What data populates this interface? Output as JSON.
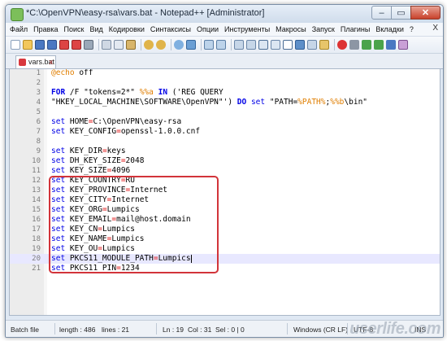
{
  "window": {
    "title": "*C:\\OpenVPN\\easy-rsa\\vars.bat - Notepad++ [Administrator]",
    "minimize": "–",
    "maximize": "▭",
    "close": "✕"
  },
  "menu": {
    "items": [
      "Файл",
      "Правка",
      "Поиск",
      "Вид",
      "Кодировки",
      "Синтаксисы",
      "Опции",
      "Инструменты",
      "Макросы",
      "Запуск",
      "Плагины",
      "Вкладки",
      "?"
    ],
    "close_x": "X"
  },
  "tab": {
    "label": "vars.bat",
    "close": "x"
  },
  "editor": {
    "current_line": 19,
    "lines": [
      {
        "n": "1"
      },
      {
        "n": "2"
      },
      {
        "n": "3"
      },
      {
        "n": "4"
      },
      {
        "n": "5"
      },
      {
        "n": "6"
      },
      {
        "n": "7"
      },
      {
        "n": "8"
      },
      {
        "n": "9"
      },
      {
        "n": "10"
      },
      {
        "n": "11"
      },
      {
        "n": "12"
      },
      {
        "n": "13"
      },
      {
        "n": "14"
      },
      {
        "n": "15"
      },
      {
        "n": "16"
      },
      {
        "n": "17"
      },
      {
        "n": "18"
      },
      {
        "n": "19"
      },
      {
        "n": "20"
      },
      {
        "n": "21"
      }
    ],
    "code": {
      "l1_at": "@echo",
      "l1_rest": " off",
      "l3_for": "FOR",
      "l3_f": " /F ",
      "l3_q": "\"tokens=2*\"",
      "l3_var": " %%a ",
      "l3_in": "IN",
      "l3_str": " ('REG QUERY",
      "l4_str": "\"HKEY_LOCAL_MACHINE\\SOFTWARE\\OpenVPN\"') ",
      "l4_do": "DO",
      "l4_set": " set ",
      "l4_q1": "\"PATH=",
      "l4_v1": "%PATH%",
      "l4_semi": ";",
      "l4_v2": "%%b",
      "l4_end": "\\bin\"",
      "set": "set",
      "l6_id": " HOME",
      "l6_val": "C:\\OpenVPN\\easy-rsa",
      "l7_id": " KEY_CONFIG",
      "l7_val": "openssl-1.0.0.cnf",
      "l9_id": " KEY_DIR",
      "l9_val": "keys",
      "l10_id": " DH_KEY_SIZE",
      "l10_val": "2048",
      "l11_id": " KEY_SIZE",
      "l11_val": "4096",
      "l12_id": " KEY_COUNTRY",
      "l12_val": "RU",
      "l13_id": " KEY_PROVINCE",
      "l13_val": "Internet",
      "l14_id": " KEY_CITY",
      "l14_val": "Internet",
      "l15_id": " KEY_ORG",
      "l15_val": "Lumpics",
      "l16_id": " KEY_EMAIL",
      "l16_val": "mail@host.domain",
      "l17_id": " KEY_CN",
      "l17_val": "Lumpics",
      "l18_id": " KEY_NAME",
      "l18_val": "Lumpics",
      "l19_id": " KEY_OU",
      "l19_val": "Lumpics",
      "l20_id": " PKCS11_MODULE_PATH",
      "l20_val": "Lumpics",
      "l21_id": " PKCS11_PIN",
      "l21_val": "1234",
      "eq": "="
    }
  },
  "status": {
    "type": "Batch file",
    "length": "length : 486",
    "lines": "lines : 21",
    "ln": "Ln : 19",
    "col": "Col : 31",
    "sel": "Sel : 0 | 0",
    "eol": "Windows (CR LF)",
    "enc": "UTF-8",
    "mode": "INS"
  },
  "watermark": "userlife.com",
  "colors": {
    "accent_highlight": "#d2343a",
    "keyword": "#0000e6",
    "operator": "#e01010",
    "variable": "#e07e00"
  }
}
